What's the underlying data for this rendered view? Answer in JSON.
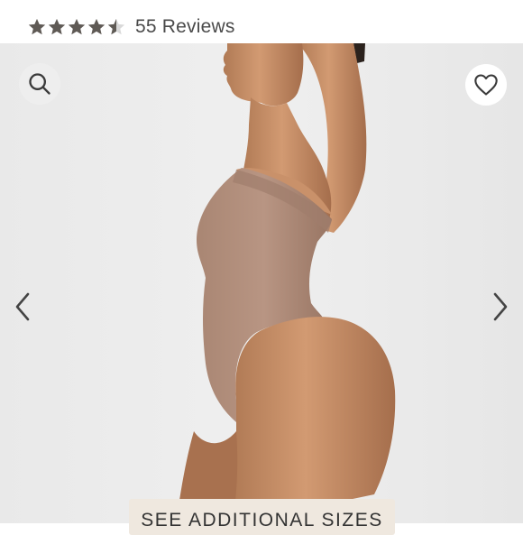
{
  "rating": {
    "value": 4.5,
    "max": 5,
    "reviews_label": "55 Reviews",
    "star_color": "#5f5a55",
    "star_empty_color": "#d9d9d9"
  },
  "gallery": {
    "background": "#ececec",
    "image_alt": "",
    "zoom_icon": "search-icon",
    "favorite_icon": "heart-icon",
    "prev_icon": "chevron-left-icon",
    "next_icon": "chevron-right-icon"
  },
  "cta": {
    "label": "SEE ADDITIONAL SIZES",
    "background": "#efe8df"
  }
}
